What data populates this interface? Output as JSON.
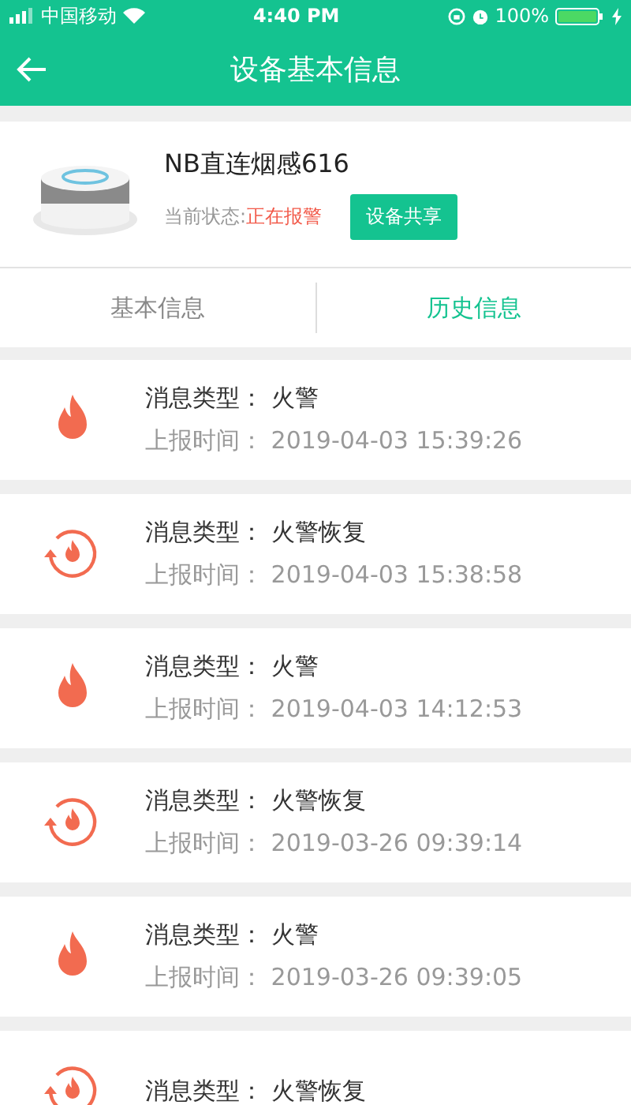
{
  "status_bar": {
    "carrier": "中国移动",
    "time": "4:40 PM",
    "battery": "100%"
  },
  "header": {
    "title": "设备基本信息"
  },
  "device": {
    "name": "NB直连烟感616",
    "status_label": "当前状态:",
    "status": "正在报警",
    "share_button": "设备共享"
  },
  "tabs": [
    {
      "label": "基本信息",
      "selected": false
    },
    {
      "label": "历史信息",
      "selected": true
    }
  ],
  "messages": [
    {
      "kind": "alarm",
      "type_label": "消息类型：",
      "type": "火警",
      "time_label": "上报时间：",
      "time": "2019-04-03 15:39:26"
    },
    {
      "kind": "recovery",
      "type_label": "消息类型：",
      "type": "火警恢复",
      "time_label": "上报时间：",
      "time": "2019-04-03 15:38:58"
    },
    {
      "kind": "alarm",
      "type_label": "消息类型：",
      "type": "火警",
      "time_label": "上报时间：",
      "time": "2019-04-03 14:12:53"
    },
    {
      "kind": "recovery",
      "type_label": "消息类型：",
      "type": "火警恢复",
      "time_label": "上报时间：",
      "time": "2019-03-26 09:39:14"
    },
    {
      "kind": "alarm",
      "type_label": "消息类型：",
      "type": "火警",
      "time_label": "上报时间：",
      "time": "2019-03-26 09:39:05"
    },
    {
      "kind": "recovery",
      "type_label": "消息类型：",
      "type": "火警恢复"
    }
  ]
}
